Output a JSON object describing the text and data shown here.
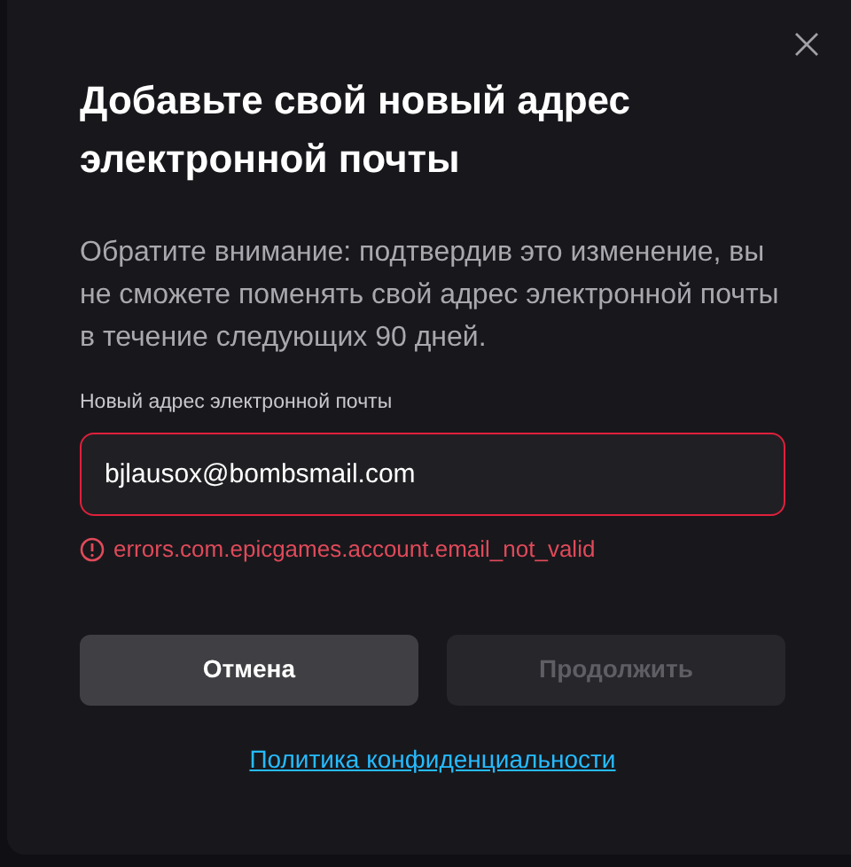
{
  "dialog": {
    "title": "Добавьте свой новый адрес электронной почты",
    "description": "Обратите внимание: подтвердив это изменение, вы не сможете поменять свой адрес электронной почты в течение следующих 90 дней.",
    "email_field": {
      "label": "Новый адрес электронной почты",
      "value": "bjlausox@bombsmail.com",
      "invalid": true
    },
    "error": "errors.com.epicgames.account.email_not_valid",
    "buttons": [
      {
        "label": "Отмена",
        "disabled": false
      },
      {
        "label": "Продолжить",
        "disabled": true
      }
    ],
    "privacy_link": "Политика конфиденциальности"
  }
}
